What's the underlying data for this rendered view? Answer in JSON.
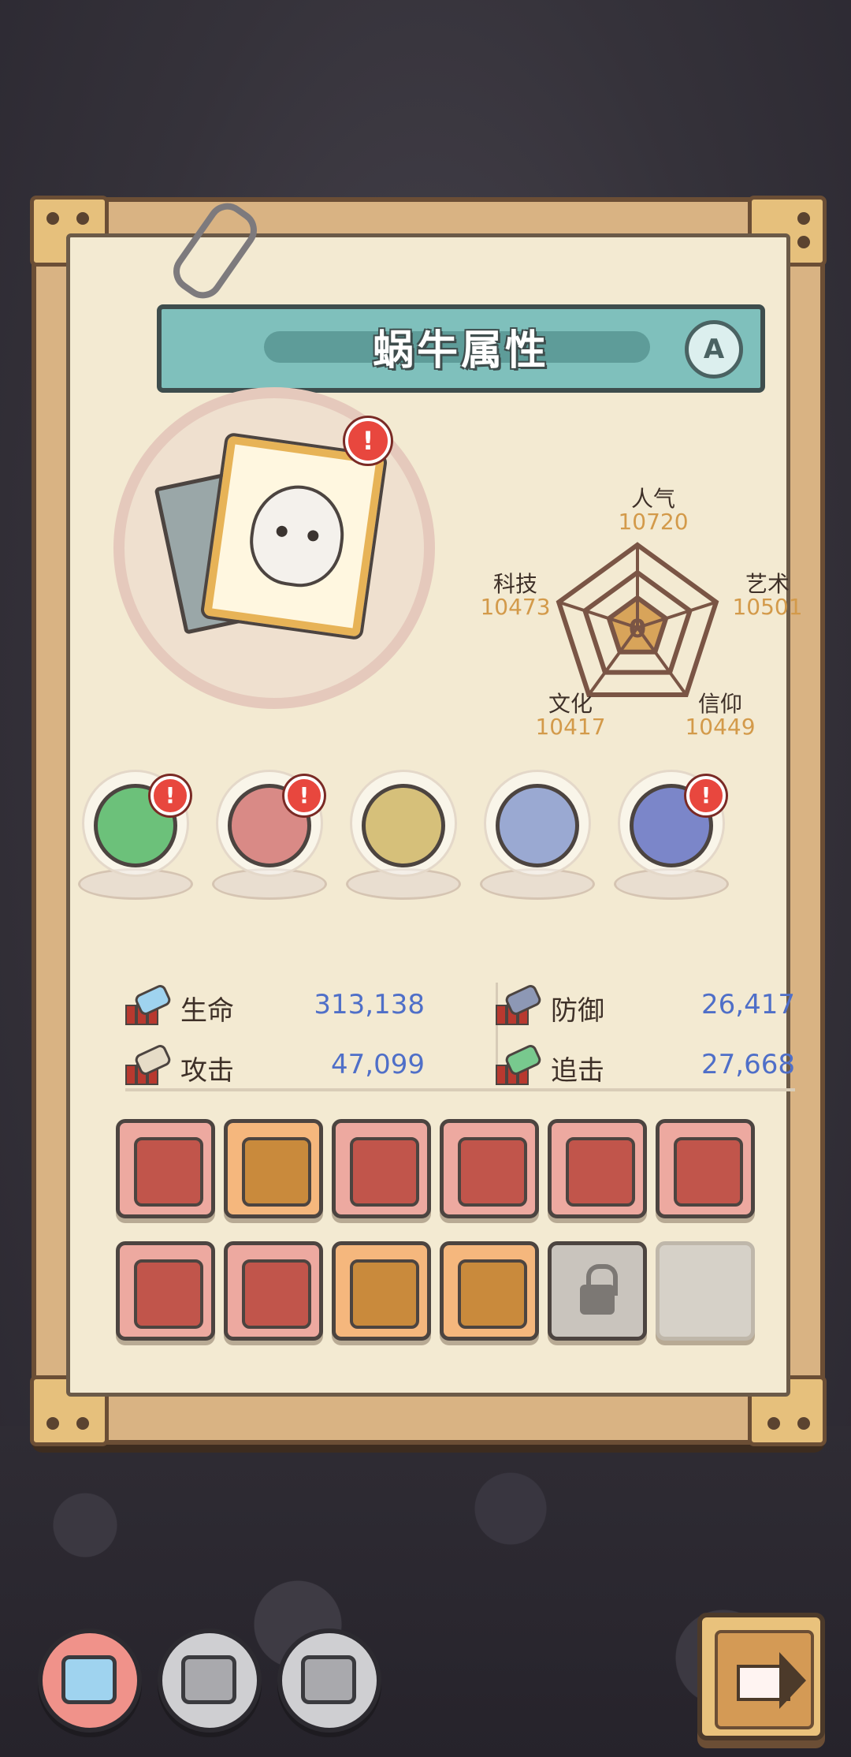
{
  "title": {
    "text": "蜗牛属性",
    "badge": "A"
  },
  "alert_mark": "!",
  "attributes": [
    {
      "label": "人气",
      "value": "10720"
    },
    {
      "label": "艺术",
      "value": "10501"
    },
    {
      "label": "信仰",
      "value": "10449"
    },
    {
      "label": "文化",
      "value": "10417"
    },
    {
      "label": "科技",
      "value": "10473"
    }
  ],
  "radar_center": "0",
  "relics": [
    {
      "name": "tentacle-relic",
      "alert": true,
      "color": "#6cc17a"
    },
    {
      "name": "monster-mouth-relic",
      "alert": true,
      "color": "#d98a86"
    },
    {
      "name": "eye-shell-relic",
      "alert": false,
      "color": "#d6c07a"
    },
    {
      "name": "compass-relic",
      "alert": false,
      "color": "#9aa9d2"
    },
    {
      "name": "cube-plate-relic",
      "alert": true,
      "color": "#7b86c9"
    }
  ],
  "stats": [
    {
      "label": "生命",
      "value": "313,138",
      "icon": "health-icon"
    },
    {
      "label": "防御",
      "value": "26,417",
      "icon": "defense-icon"
    },
    {
      "label": "攻击",
      "value": "47,099",
      "icon": "attack-icon"
    },
    {
      "label": "追击",
      "value": "27,668",
      "icon": "pursuit-icon"
    }
  ],
  "equipment": [
    {
      "name": "sword",
      "rarity": "red"
    },
    {
      "name": "ring",
      "rarity": "orange"
    },
    {
      "name": "crossbow",
      "rarity": "red"
    },
    {
      "name": "spiked-club",
      "rarity": "red"
    },
    {
      "name": "backpack",
      "rarity": "red"
    },
    {
      "name": "armor",
      "rarity": "red"
    },
    {
      "name": "crown",
      "rarity": "red"
    },
    {
      "name": "mace",
      "rarity": "red"
    },
    {
      "name": "diving-helmet",
      "rarity": "orange"
    },
    {
      "name": "bone-blade",
      "rarity": "orange"
    },
    {
      "name": "locked-slot",
      "rarity": "gray"
    },
    {
      "name": "empty-slot",
      "rarity": "empty"
    }
  ],
  "nav": [
    {
      "name": "device-tab-1",
      "active": true
    },
    {
      "name": "device-tab-2",
      "active": false
    },
    {
      "name": "device-tab-3",
      "active": false
    }
  ],
  "colors": {
    "accent_value": "#4f6fc8",
    "attr_value": "#d39a4a",
    "alert": "#e8473e",
    "title_bg": "#7fc0bc"
  }
}
